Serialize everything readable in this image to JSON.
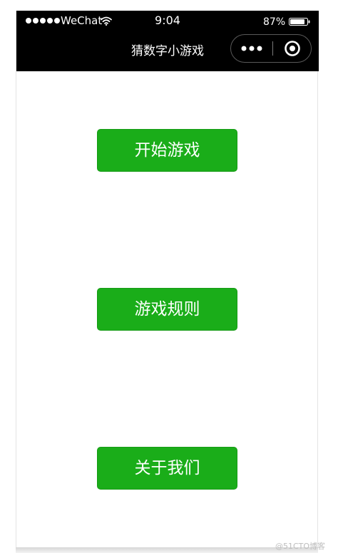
{
  "status_bar": {
    "carrier": "WeChat",
    "time": "9:04",
    "battery_percent": "87%",
    "battery_level": 0.87,
    "signal_strength": 5
  },
  "nav": {
    "title": "猜数字小游戏",
    "capsule_icons": [
      "more-dots-icon",
      "close-target-icon"
    ]
  },
  "menu": {
    "start_label": "开始游戏",
    "rules_label": "游戏规则",
    "about_label": "关于我们"
  },
  "watermark": "@51CTO博客",
  "colors": {
    "navbar_bg": "#000000",
    "button_green": "#1aad19",
    "page_bg": "#ffffff"
  }
}
